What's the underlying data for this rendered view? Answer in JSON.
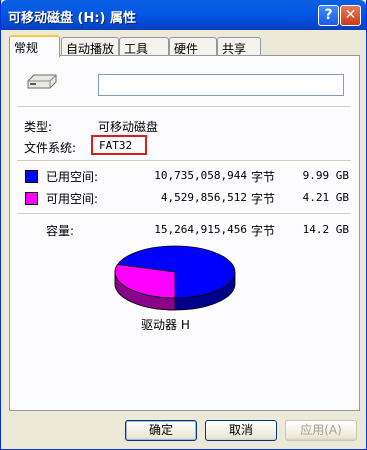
{
  "window": {
    "title": "可移动磁盘 (H:) 属性",
    "help_glyph": "?",
    "close_glyph": "✕"
  },
  "tabs": [
    {
      "label": "常规",
      "active": true
    },
    {
      "label": "自动播放",
      "active": false
    },
    {
      "label": "工具",
      "active": false
    },
    {
      "label": "硬件",
      "active": false
    },
    {
      "label": "共享",
      "active": false
    }
  ],
  "general": {
    "name_value": "",
    "type_label": "类型:",
    "type_value": "可移动磁盘",
    "fs_label": "文件系统:",
    "fs_value": "FAT32",
    "used": {
      "label": "已用空间:",
      "bytes": "10,735,058,944",
      "unit": "字节",
      "size": "9.99 GB",
      "color": "#0000ff"
    },
    "free": {
      "label": "可用空间:",
      "bytes": "4,529,856,512",
      "unit": "字节",
      "size": "4.21 GB",
      "color": "#ff00ff"
    },
    "capacity": {
      "label": "容量:",
      "bytes": "15,264,915,456",
      "unit": "字节",
      "size": "14.2 GB"
    },
    "drive_label": "驱动器 H"
  },
  "pie": {
    "used_fraction": 0.703,
    "free_fraction": 0.297
  },
  "buttons": {
    "ok": "确定",
    "cancel": "取消",
    "apply": "应用(A)"
  }
}
